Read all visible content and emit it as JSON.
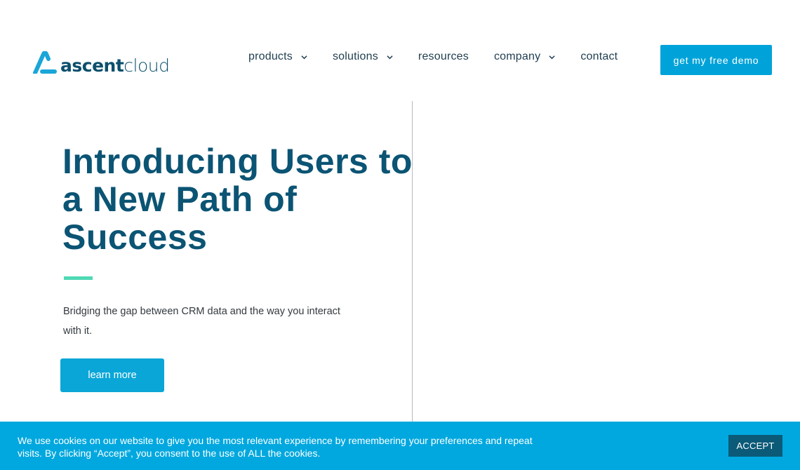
{
  "brand": {
    "name_part1": "ascent",
    "name_part2": "cloud",
    "logo_icon": "ascent-mountain-icon",
    "colors": {
      "primary": "#0b5474",
      "accent_blue": "#00a3d9",
      "accent_green": "#4fd9b4",
      "logo_blue": "#1aa6d8"
    }
  },
  "nav": {
    "items": [
      {
        "label": "products",
        "has_dropdown": true,
        "icon": "chevron-down-icon"
      },
      {
        "label": "solutions",
        "has_dropdown": true,
        "icon": "chevron-down-icon"
      },
      {
        "label": "resources",
        "has_dropdown": false
      },
      {
        "label": "company",
        "has_dropdown": true,
        "icon": "chevron-down-icon"
      },
      {
        "label": "contact",
        "has_dropdown": false
      }
    ],
    "cta_label": "get my free demo"
  },
  "hero": {
    "title": "Introducing Users to a New Path of Success",
    "subtitle": "Bridging the gap between CRM data and the way you interact with it.",
    "button_label": "learn more"
  },
  "cookie_banner": {
    "text": "We use cookies on our website to give you the most relevant experience by remembering your preferences and repeat visits. By clicking “Accept”, you consent to the use of ALL the cookies.",
    "accept_label": "ACCEPT"
  }
}
